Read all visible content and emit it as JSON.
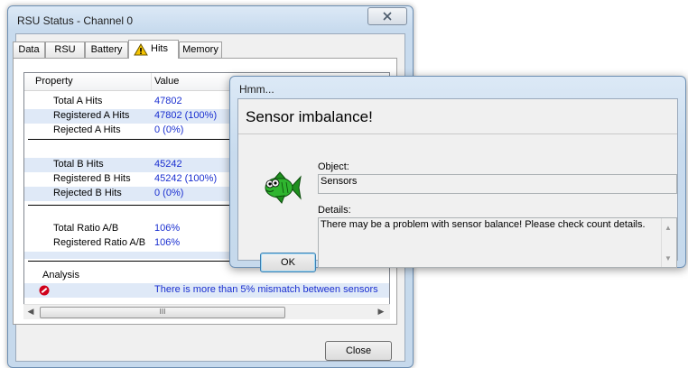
{
  "main_window": {
    "title": "RSU Status - Channel 0",
    "close_glyph": "X",
    "tabs": [
      {
        "label": "Data"
      },
      {
        "label": "RSU"
      },
      {
        "label": "Battery"
      },
      {
        "label": "Hits",
        "icon": "warning-icon",
        "active": true
      },
      {
        "label": "Memory"
      }
    ],
    "columns": [
      "Property",
      "Value"
    ],
    "rows": [
      {
        "property": "Total A Hits",
        "value": "47802"
      },
      {
        "property": "Registered A Hits",
        "value": "47802 (100%)"
      },
      {
        "property": "Rejected A Hits",
        "value": "0 (0%)"
      },
      {
        "property": "Total B Hits",
        "value": "45242"
      },
      {
        "property": "Registered B Hits",
        "value": "45242 (100%)"
      },
      {
        "property": "Rejected B Hits",
        "value": "0 (0%)"
      },
      {
        "property": "Total Ratio A/B",
        "value": "106%"
      },
      {
        "property": "Registered Ratio A/B",
        "value": "106%"
      },
      {
        "property": "Analysis",
        "value": ""
      },
      {
        "property": "",
        "value": "There is more than 5% mismatch between sensors",
        "icon": "error-icon"
      }
    ],
    "scroll_thumb_glyph": "III",
    "close_button": "Close"
  },
  "dialog": {
    "title": "Hmm...",
    "heading": "Sensor imbalance!",
    "object_label": "Object:",
    "object_value": "Sensors",
    "details_label": "Details:",
    "details_value": "There may be a problem with sensor balance! Please check count details.",
    "ok_button": "OK",
    "icon": "fish-icon"
  },
  "colors": {
    "value_text": "#1a2fd0",
    "selected_row": "#dfe9f7",
    "fish_green": "#2fb52f",
    "warning_yellow": "#f5c400",
    "error_red": "#d0021b"
  }
}
